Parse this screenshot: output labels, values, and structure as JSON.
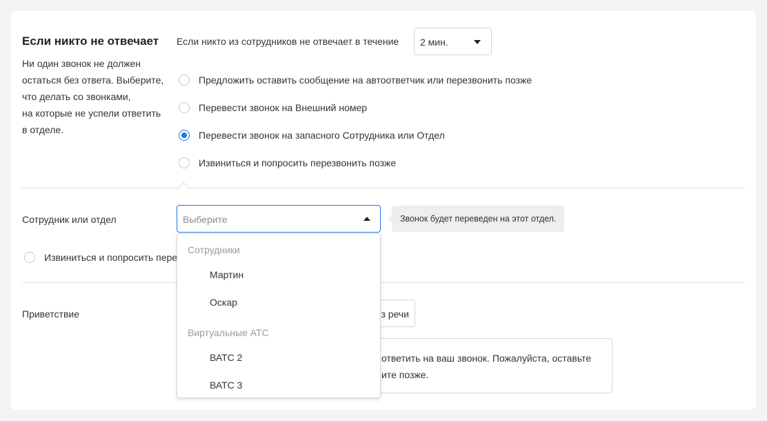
{
  "section_no_answer": {
    "title": "Если никто не отвечает",
    "description_lines": [
      "Ни один звонок не должен",
      "остаться без ответа. Выберите,",
      "что делать со звонками,",
      "на которые не успели ответить",
      "в отделе."
    ],
    "timeout_label": "Если никто из сотрудников не отвечает в течение",
    "timeout_value": "2 мин.",
    "options": [
      {
        "label": "Предложить оставить сообщение на автоответчик или перезвонить позже",
        "checked": false
      },
      {
        "label": "Перевести звонок на Внешний номер",
        "checked": false
      },
      {
        "label": "Перевести звонок на запасного Сотрудника или Отдел",
        "checked": true
      },
      {
        "label": "Извиниться и попросить перезвонить позже",
        "checked": false
      }
    ]
  },
  "employee_dept": {
    "label": "Сотрудник или отдел",
    "placeholder": "Выберите",
    "tooltip": "Звонок будет переведен на этот отдел.",
    "fallback_option_label": "Извиниться и попросить пере"
  },
  "dropdown": {
    "groups": [
      {
        "label": "Сотрудники",
        "items": [
          "Мартин",
          "Оскар"
        ]
      },
      {
        "label": "Виртуальные АТС",
        "items": [
          "ВАТС 2",
          "ВАТС 3"
        ]
      }
    ]
  },
  "greeting": {
    "label": "Приветствие",
    "button_partial": "з речи",
    "text_lines": [
      " ответить на ваш звонок. Пожалуйста, оставьте",
      "ите позже."
    ]
  },
  "colors": {
    "accent": "#1f77e0",
    "page_bg": "#f2f3f3",
    "card_bg": "#ffffff"
  }
}
